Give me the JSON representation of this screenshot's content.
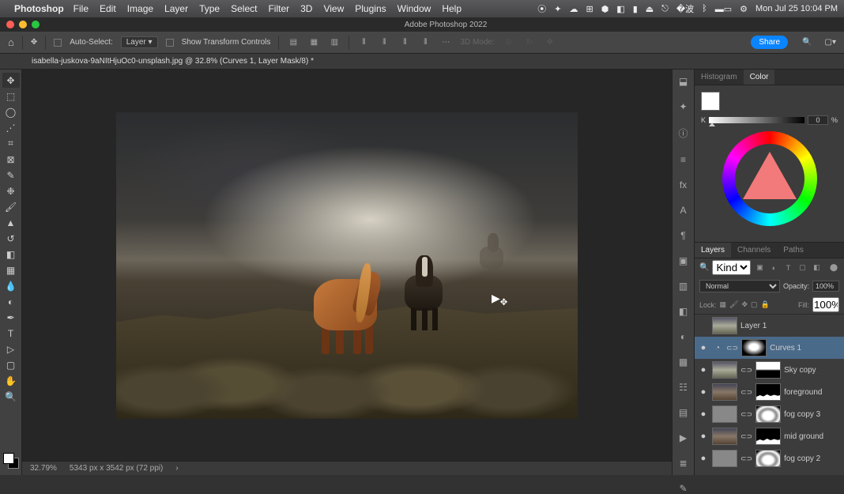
{
  "menubar": {
    "app": "Photoshop",
    "items": [
      "File",
      "Edit",
      "Image",
      "Layer",
      "Type",
      "Select",
      "Filter",
      "3D",
      "View",
      "Plugins",
      "Window",
      "Help"
    ],
    "clock": "Mon Jul 25  10:04 PM"
  },
  "titlebar": {
    "title": "Adobe Photoshop 2022"
  },
  "options": {
    "auto_select": "Auto-Select:",
    "layer_dropdown": "Layer",
    "show_transform": "Show Transform Controls",
    "mode_3d": "3D Mode:",
    "share": "Share"
  },
  "tab": {
    "name": "isabella-juskova-9aNItHjuOc0-unsplash.jpg @ 32.8% (Curves 1, Layer Mask/8) *"
  },
  "status": {
    "zoom": "32.79%",
    "dims": "5343 px x 3542 px (72 ppi)"
  },
  "color": {
    "tabs": [
      "Histogram",
      "Color"
    ],
    "k_value": "0",
    "k_pct": "%"
  },
  "layers": {
    "tabs": [
      "Layers",
      "Channels",
      "Paths"
    ],
    "filter_kind": "Kind",
    "blend": "Normal",
    "opacity_label": "Opacity:",
    "opacity_value": "100%",
    "lock_label": "Lock:",
    "fill_label": "Fill:",
    "fill_value": "100%",
    "items": [
      {
        "name": "Layer 1",
        "eye": "",
        "type": "img",
        "thumb": "sky",
        "mask": ""
      },
      {
        "name": "Curves 1",
        "eye": "●",
        "type": "adj",
        "thumb": "",
        "mask": "grad",
        "selected": true
      },
      {
        "name": "Sky copy",
        "eye": "●",
        "type": "img",
        "thumb": "sky",
        "mask": "topwhite"
      },
      {
        "name": "foreground",
        "eye": "●",
        "type": "img",
        "thumb": "horse",
        "mask": "sil"
      },
      {
        "name": "fog copy 3",
        "eye": "●",
        "type": "img",
        "thumb": "gray",
        "mask": "grad2"
      },
      {
        "name": "mid ground",
        "eye": "●",
        "type": "img",
        "thumb": "horse",
        "mask": "sil"
      },
      {
        "name": "fog copy 2",
        "eye": "●",
        "type": "img",
        "thumb": "gray",
        "mask": "grad2"
      }
    ]
  }
}
